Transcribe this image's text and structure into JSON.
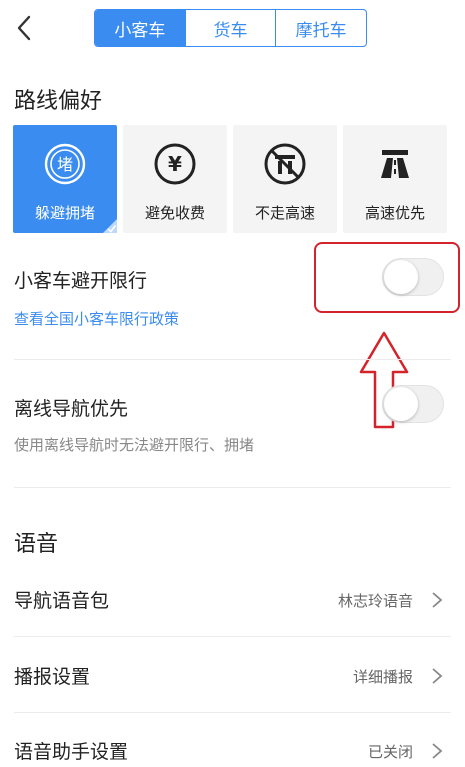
{
  "tabs": [
    {
      "label": "小客车",
      "active": true
    },
    {
      "label": "货车",
      "active": false
    },
    {
      "label": "摩托车",
      "active": false
    }
  ],
  "route_pref": {
    "title": "路线偏好",
    "options": [
      {
        "label": "躲避拥堵",
        "icon": "avoid-congestion-icon",
        "active": true
      },
      {
        "label": "避免收费",
        "icon": "avoid-toll-icon",
        "active": false
      },
      {
        "label": "不走高速",
        "icon": "no-highway-icon",
        "active": false
      },
      {
        "label": "高速优先",
        "icon": "highway-icon",
        "active": false
      }
    ]
  },
  "restriction": {
    "title": "小客车避开限行",
    "link": "查看全国小客车限行政策",
    "enabled": false
  },
  "offline": {
    "title": "离线导航优先",
    "subtitle": "使用离线导航时无法避开限行、拥堵",
    "enabled": false
  },
  "voice": {
    "title": "语音",
    "items": [
      {
        "label": "导航语音包",
        "value": "林志玲语音"
      },
      {
        "label": "播报设置",
        "value": "详细播报"
      },
      {
        "label": "语音助手设置",
        "value": "已关闭"
      }
    ]
  },
  "colors": {
    "accent": "#3b8cf0",
    "annotation": "#d3242b"
  }
}
